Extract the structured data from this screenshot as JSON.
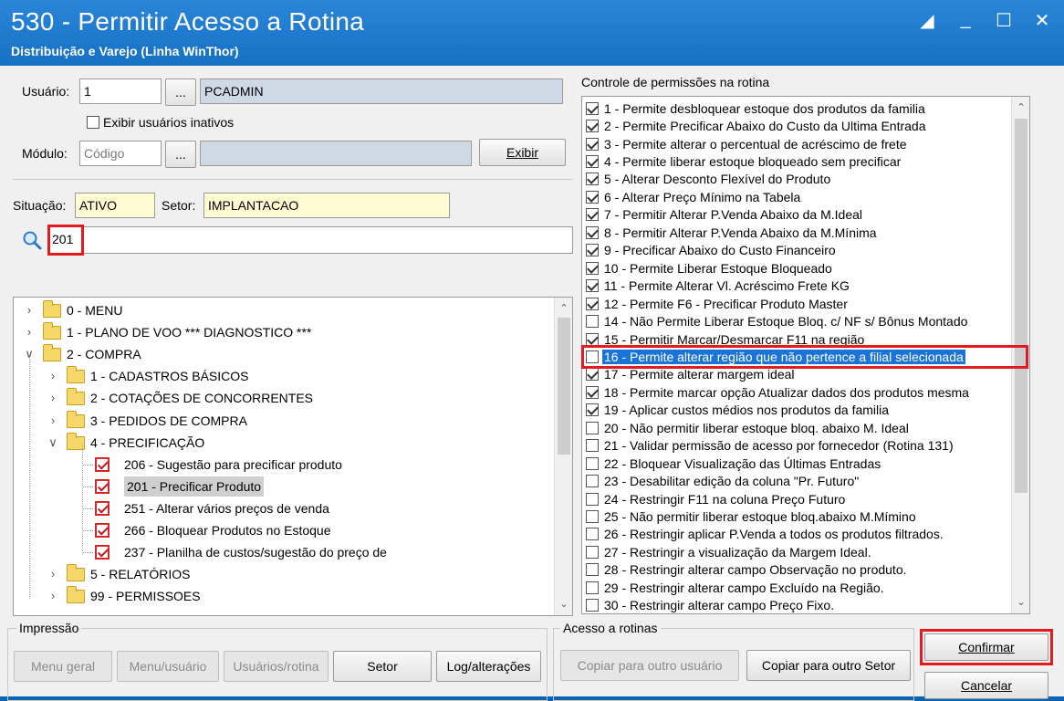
{
  "window": {
    "title": "530 - Permitir Acesso a Rotina",
    "subtitle": "Distribuição e Varejo (Linha WinThor)"
  },
  "user_section": {
    "usuario_label": "Usuário:",
    "usuario_code": "1",
    "usuario_name": "PCADMIN",
    "lookup_label": "...",
    "inactive_label": "Exibir usuários inativos",
    "inactive_checked": false,
    "modulo_label": "Módulo:",
    "modulo_placeholder": "Código",
    "exibir_label": "Exibir",
    "situacao_label": "Situação:",
    "situacao_value": "ATIVO",
    "setor_label": "Setor:",
    "setor_value": "IMPLANTACAO",
    "search_value": "201"
  },
  "tree": [
    {
      "label": "0 - MENU",
      "level": 0,
      "type": "folder",
      "expanded": false
    },
    {
      "label": "1 - PLANO DE VOO  *** DIAGNOSTICO ***",
      "level": 0,
      "type": "folder",
      "expanded": false
    },
    {
      "label": "2 - COMPRA",
      "level": 0,
      "type": "folder",
      "expanded": true
    },
    {
      "label": "1 - CADASTROS BÁSICOS",
      "level": 1,
      "type": "folder",
      "expanded": false
    },
    {
      "label": "2 - COTAÇÕES DE CONCORRENTES",
      "level": 1,
      "type": "folder",
      "expanded": false
    },
    {
      "label": "3 - PEDIDOS DE COMPRA",
      "level": 1,
      "type": "folder",
      "expanded": false
    },
    {
      "label": "4 - PRECIFICAÇÃO",
      "level": 1,
      "type": "folder",
      "expanded": true
    },
    {
      "label": "206 - Sugestão para precificar produto",
      "level": 2,
      "type": "item",
      "checked": true
    },
    {
      "label": "201 - Precificar Produto",
      "level": 2,
      "type": "item",
      "checked": true,
      "selected": true
    },
    {
      "label": "251 - Alterar vários preços de venda",
      "level": 2,
      "type": "item",
      "checked": true
    },
    {
      "label": "266 - Bloquear Produtos no Estoque",
      "level": 2,
      "type": "item",
      "checked": true
    },
    {
      "label": "237 - Planilha de custos/sugestão do preço de",
      "level": 2,
      "type": "item",
      "checked": true
    },
    {
      "label": "5 - RELATÓRIOS",
      "level": 1,
      "type": "folder",
      "expanded": false
    },
    {
      "label": "99 - PERMISSOES",
      "level": 1,
      "type": "folder",
      "expanded": false
    }
  ],
  "permissions": {
    "title": "Controle de permissões na rotina",
    "items": [
      {
        "label": "1 - Permite desbloquear estoque dos produtos da familia",
        "checked": true
      },
      {
        "label": "2 - Permite Precificar Abaixo do Custo da Ultima Entrada",
        "checked": true
      },
      {
        "label": "3 - Permite alterar o percentual de acréscimo de frete",
        "checked": true
      },
      {
        "label": "4 - Permite liberar estoque bloqueado sem precificar",
        "checked": true
      },
      {
        "label": "5 - Alterar Desconto Flexível do Produto",
        "checked": true
      },
      {
        "label": "6 - Alterar Preço Mínimo na Tabela",
        "checked": true
      },
      {
        "label": "7 - Permitir Alterar P.Venda Abaixo da M.Ideal",
        "checked": true
      },
      {
        "label": "8 - Permitir Alterar P.Venda Abaixo da M.Mínima",
        "checked": true
      },
      {
        "label": "9 - Precificar Abaixo do Custo Financeiro",
        "checked": true
      },
      {
        "label": "10 - Permite Liberar Estoque Bloqueado",
        "checked": true
      },
      {
        "label": "11 - Permite Alterar Vl. Acréscimo Frete KG",
        "checked": true
      },
      {
        "label": "12 - Permite F6 - Precificar Produto Master",
        "checked": true
      },
      {
        "label": "14 - Não Permite Liberar Estoque Bloq. c/ NF s/ Bônus Montado",
        "checked": false
      },
      {
        "label": "15 - Permitir Marcar/Desmarcar F11 na região",
        "checked": true
      },
      {
        "label": "16 - Permite alterar região que não pertence a filial selecionada",
        "checked": false,
        "selected": true
      },
      {
        "label": "17 - Permite alterar margem ideal",
        "checked": true
      },
      {
        "label": "18 - Permite marcar opção Atualizar dados dos produtos mesma",
        "checked": true
      },
      {
        "label": "19 - Aplicar custos médios nos produtos da familia",
        "checked": true
      },
      {
        "label": "20 - Não permitir liberar estoque bloq. abaixo M. Ideal",
        "checked": false
      },
      {
        "label": "21 - Validar permissão de acesso por fornecedor (Rotina 131)",
        "checked": false
      },
      {
        "label": "22 - Bloquear Visualização das Últimas Entradas",
        "checked": false
      },
      {
        "label": "23 - Desabilitar edição da coluna \"Pr. Futuro\"",
        "checked": false
      },
      {
        "label": "24 - Restringir F11 na coluna Preço Futuro",
        "checked": false
      },
      {
        "label": "25 - Não permitir liberar estoque bloq.abaixo M.Mímino",
        "checked": false
      },
      {
        "label": "26 - Restringir aplicar P.Venda a todos os produtos filtrados.",
        "checked": false
      },
      {
        "label": "27 - Restringir a visualização da Margem Ideal.",
        "checked": false
      },
      {
        "label": "28 - Restringir alterar campo Observação no produto.",
        "checked": false
      },
      {
        "label": "29 - Restringir alterar campo Excluído na Região.",
        "checked": false
      },
      {
        "label": "30 - Restringir alterar campo Preço Fixo.",
        "checked": false
      }
    ]
  },
  "impressao": {
    "title": "Impressão",
    "menu_geral": "Menu geral",
    "menu_usuario": "Menu/usuário",
    "usuarios_rotina": "Usuários/rotina",
    "setor": "Setor",
    "log": "Log/alterações"
  },
  "acesso": {
    "title": "Acesso a rotinas",
    "copiar_usuario": "Copiar para outro usuário",
    "copiar_setor": "Copiar para outro Setor"
  },
  "actions": {
    "confirmar": "Confirmar",
    "cancelar": "Cancelar"
  },
  "colors": {
    "title_bar": "#1670c4",
    "selection": "#1a73d6",
    "highlight_border": "#e41a1f"
  }
}
